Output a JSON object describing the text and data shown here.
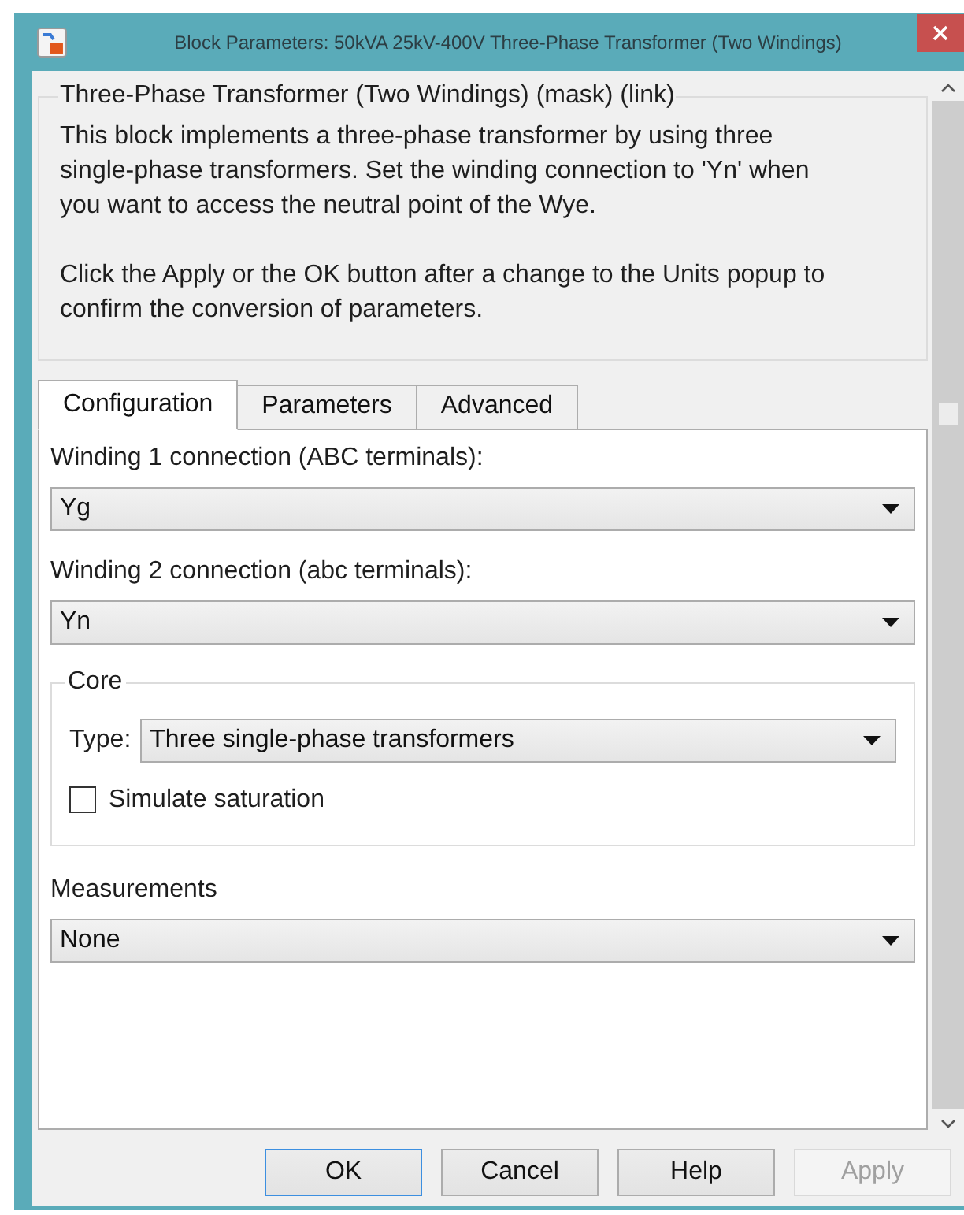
{
  "window": {
    "title": "Block Parameters: 50kVA 25kV-400V Three-Phase Transformer (Two Windings)"
  },
  "description": {
    "title": "Three-Phase Transformer (Two Windings) (mask) (link)",
    "paragraphs": [
      "This block implements a three-phase transformer by using three single-phase transformers. Set the winding connection to 'Yn' when you want to access the neutral point of the Wye.",
      "Click the Apply or the OK button after a change to the Units popup to confirm the conversion of parameters."
    ]
  },
  "tabs": [
    {
      "label": "Configuration",
      "selected": true
    },
    {
      "label": "Parameters",
      "selected": false
    },
    {
      "label": "Advanced",
      "selected": false
    }
  ],
  "fields": [
    {
      "kind": "dropdown",
      "label": "Winding 1 connection (ABC terminals):",
      "value": "Yg"
    },
    {
      "kind": "dropdown",
      "label": "Winding 2 connection (abc terminals):",
      "value": "Yn"
    },
    {
      "kind": "group",
      "title": "Core",
      "type_label": "Type:",
      "type_value": "Three single-phase transformers",
      "checkbox": {
        "label": "Simulate saturation",
        "checked": false
      }
    },
    {
      "kind": "dropdown",
      "label": "Measurements",
      "value": "None"
    }
  ],
  "buttons": [
    {
      "label": "OK",
      "default": true,
      "disabled": false
    },
    {
      "label": "Cancel",
      "default": false,
      "disabled": false
    },
    {
      "label": "Help",
      "default": false,
      "disabled": false
    },
    {
      "label": "Apply",
      "default": false,
      "disabled": true
    }
  ]
}
